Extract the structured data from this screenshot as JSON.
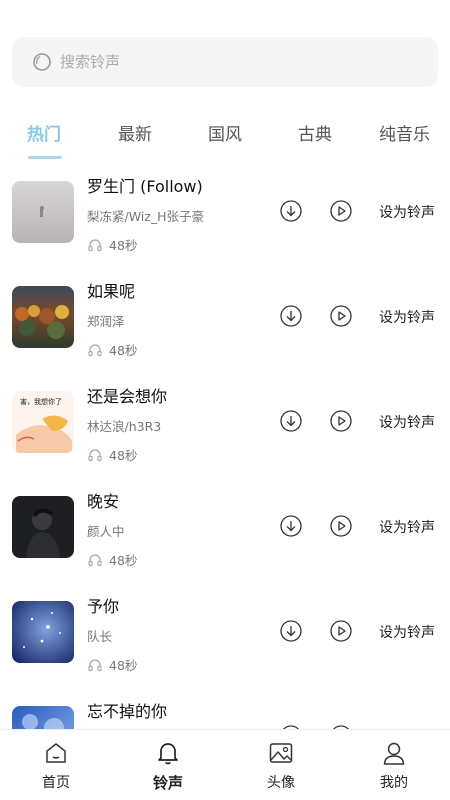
{
  "search": {
    "placeholder": "搜索铃声"
  },
  "tabs": [
    {
      "label": "热门",
      "active": true
    },
    {
      "label": "最新",
      "active": false
    },
    {
      "label": "国风",
      "active": false
    },
    {
      "label": "古典",
      "active": false
    },
    {
      "label": "纯音乐",
      "active": false
    }
  ],
  "set_ringtone_label": "设为铃声",
  "songs": [
    {
      "title": "罗生门 (Follow)",
      "artist": "梨冻紧/Wiz_H张子豪",
      "duration": "48秒"
    },
    {
      "title": "如果呢",
      "artist": "郑润泽",
      "duration": "48秒"
    },
    {
      "title": "还是会想你",
      "artist": "林达浪/h3R3",
      "duration": "48秒",
      "cover_text": "害，我想你了"
    },
    {
      "title": "晚安",
      "artist": "颜人中",
      "duration": "48秒"
    },
    {
      "title": "予你",
      "artist": "队长",
      "duration": "48秒"
    },
    {
      "title": "忘不掉的你",
      "artist": "",
      "duration": ""
    }
  ],
  "bottom_nav": [
    {
      "label": "首页",
      "icon": "home-icon",
      "active": false
    },
    {
      "label": "铃声",
      "icon": "bell-icon",
      "active": true
    },
    {
      "label": "头像",
      "icon": "image-icon",
      "active": false
    },
    {
      "label": "我的",
      "icon": "user-icon",
      "active": false
    }
  ],
  "colors": {
    "accent": "#86c9e3",
    "underline": "#a8d8ea"
  }
}
